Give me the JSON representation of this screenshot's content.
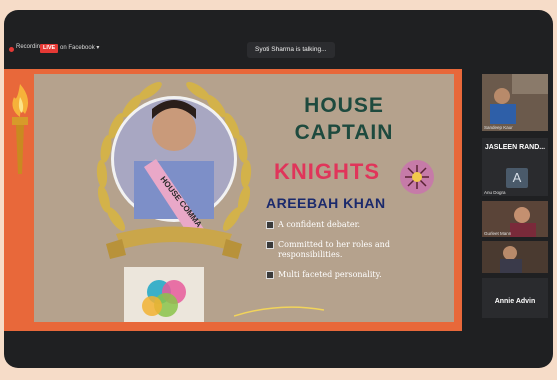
{
  "topbar": {
    "recording_label": "Recording",
    "live_badge": "LIVE",
    "platform_label": "on Facebook ▾",
    "talking_indicator": "Syoti Sharma is talking..."
  },
  "slide": {
    "photo_sash_text": "HOUSE COMMA",
    "title_line1": "HOUSE",
    "title_line2": "CAPTAIN",
    "house_name": "KNIGHTS",
    "captain_name": "AREEBAH KHAN",
    "bullets": [
      "A confident debater.",
      "Committed to her roles and responsibilities.",
      "Multi faceted personality."
    ],
    "colors": {
      "border": "#e8683a",
      "panel": "#b5a28d",
      "title": "#1e4a3e",
      "house": "#e0355a",
      "name": "#1b2a6c"
    }
  },
  "participants": [
    {
      "caption": "Sandeep Kaur",
      "name": "",
      "type": "video"
    },
    {
      "caption": "",
      "name": "JASLEEN RAND...",
      "type": "name"
    },
    {
      "caption": "Anu Dogra",
      "avatar_letter": "A",
      "type": "avatar"
    },
    {
      "caption": "Gurleet Mann",
      "type": "video"
    },
    {
      "caption": "",
      "name": "Annie Advin",
      "type": "video-name"
    }
  ]
}
